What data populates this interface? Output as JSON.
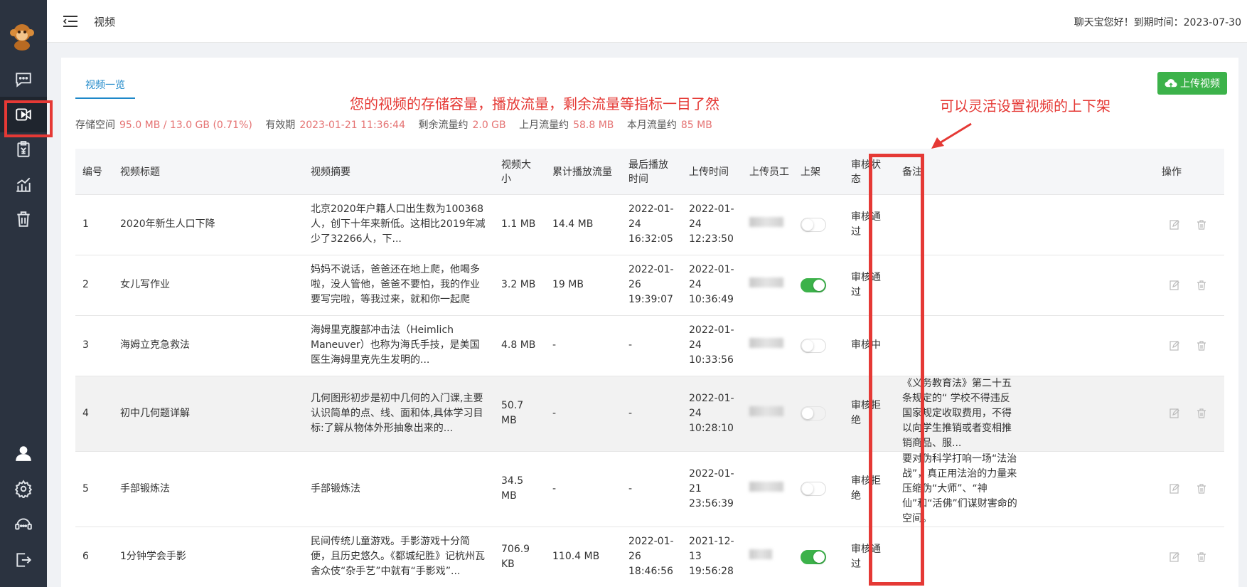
{
  "header": {
    "page_title": "视频",
    "greeting": "聊天宝您好！到期时间：2023-07-30"
  },
  "sidebar": {
    "items": [
      {
        "icon": "chat-icon"
      },
      {
        "icon": "video-icon",
        "active": true
      },
      {
        "icon": "billing-icon"
      },
      {
        "icon": "chart-icon"
      },
      {
        "icon": "trash-icon"
      },
      {
        "icon": "user-icon"
      },
      {
        "icon": "gear-icon"
      },
      {
        "icon": "support-icon"
      },
      {
        "icon": "logout-icon"
      }
    ]
  },
  "tabs": {
    "video_list": "视频一览"
  },
  "upload_button": "上传视频",
  "stats": {
    "storage_label": "存储空间",
    "storage_value": "95.0 MB / 13.0 GB (0.71%)",
    "validity_label": "有效期",
    "validity_value": "2023-01-21 11:36:44",
    "remaining_label": "剩余流量约",
    "remaining_value": "2.0 GB",
    "last_month_label": "上月流量约",
    "last_month_value": "58.8 MB",
    "this_month_label": "本月流量约",
    "this_month_value": "85 MB"
  },
  "annotations": {
    "storage_note": "您的视频的存储容量，播放流量，剩余流量等指标一目了然",
    "shelf_note": "可以灵活设置视频的上下架"
  },
  "table": {
    "headers": [
      "编号",
      "视频标题",
      "视频摘要",
      "视频大小",
      "累计播放流量",
      "最后播放时间",
      "上传时间",
      "上传员工",
      "上架",
      "审核状态",
      "备注",
      "操作"
    ],
    "rows": [
      {
        "id": "1",
        "title": "2020年新生人口下降",
        "summary": "北京2020年户籍人口出生数为100368人，创下十年来新低。这相比2019年减少了32266人，下...",
        "size": "1.1 MB",
        "traffic": "14.4 MB",
        "last_play": "2022-01-24 16:32:05",
        "upload_time": "2022-01-24 12:23:50",
        "on_shelf": false,
        "status": "审核通过",
        "remark": ""
      },
      {
        "id": "2",
        "title": "女儿写作业",
        "summary": "妈妈不说话，爸爸还在地上爬，他喝多啦，没人管他，爸爸不要怕，我的作业要写完啦，等我过来，就和你一起爬",
        "size": "3.2 MB",
        "traffic": "19 MB",
        "last_play": "2022-01-26 19:39:07",
        "upload_time": "2022-01-24 10:36:49",
        "on_shelf": true,
        "status": "审核通过",
        "remark": ""
      },
      {
        "id": "3",
        "title": "海姆立克急救法",
        "summary": "海姆里克腹部冲击法（Heimlich Maneuver）也称为海氏手技，是美国医生海姆里克先生发明的...",
        "size": "4.8 MB",
        "traffic": "-",
        "last_play": "-",
        "upload_time": "2022-01-24 10:33:56",
        "on_shelf": false,
        "status": "审核中",
        "remark": ""
      },
      {
        "id": "4",
        "title": "初中几何题详解",
        "summary": "几何图形初步是初中几何的入门课,主要认识简单的点、线、面和体,具体学习目标:了解从物体外形抽象出来的...",
        "size": "50.7 MB",
        "traffic": "-",
        "last_play": "-",
        "upload_time": "2022-01-24 10:28:10",
        "on_shelf": false,
        "status": "审核拒绝",
        "remark": "《义务教育法》第二十五条规定的“ 学校不得违反国家规定收取费用，不得以向学生推销或者变相推销商品、服..."
      },
      {
        "id": "5",
        "title": "手部锻炼法",
        "summary": "手部锻炼法",
        "size": "34.5 MB",
        "traffic": "-",
        "last_play": "-",
        "upload_time": "2022-01-21 23:56:39",
        "on_shelf": false,
        "status": "审核拒绝",
        "remark": "要对伪科学打响一场“法治战”，真正用法治的力量来压缩伪“大师”、“神仙”和“活佛”们谋财害命的空间。"
      },
      {
        "id": "6",
        "title": "1分钟学会手影",
        "summary": "民间传统儿童游戏。手影游戏十分简便，且历史悠久。《都城纪胜》记杭州瓦舍众伎“杂手艺”中就有“手影戏”...",
        "size": "706.9 KB",
        "traffic": "110.4 MB",
        "last_play": "2022-01-26 18:46:56",
        "upload_time": "2021-12-13 19:56:28",
        "on_shelf": true,
        "status": "审核通过",
        "remark": ""
      }
    ]
  },
  "colors": {
    "sidebar_bg": "#2b3340",
    "accent": "#1e88c9",
    "success": "#3cb24a",
    "highlight": "#e53935"
  }
}
